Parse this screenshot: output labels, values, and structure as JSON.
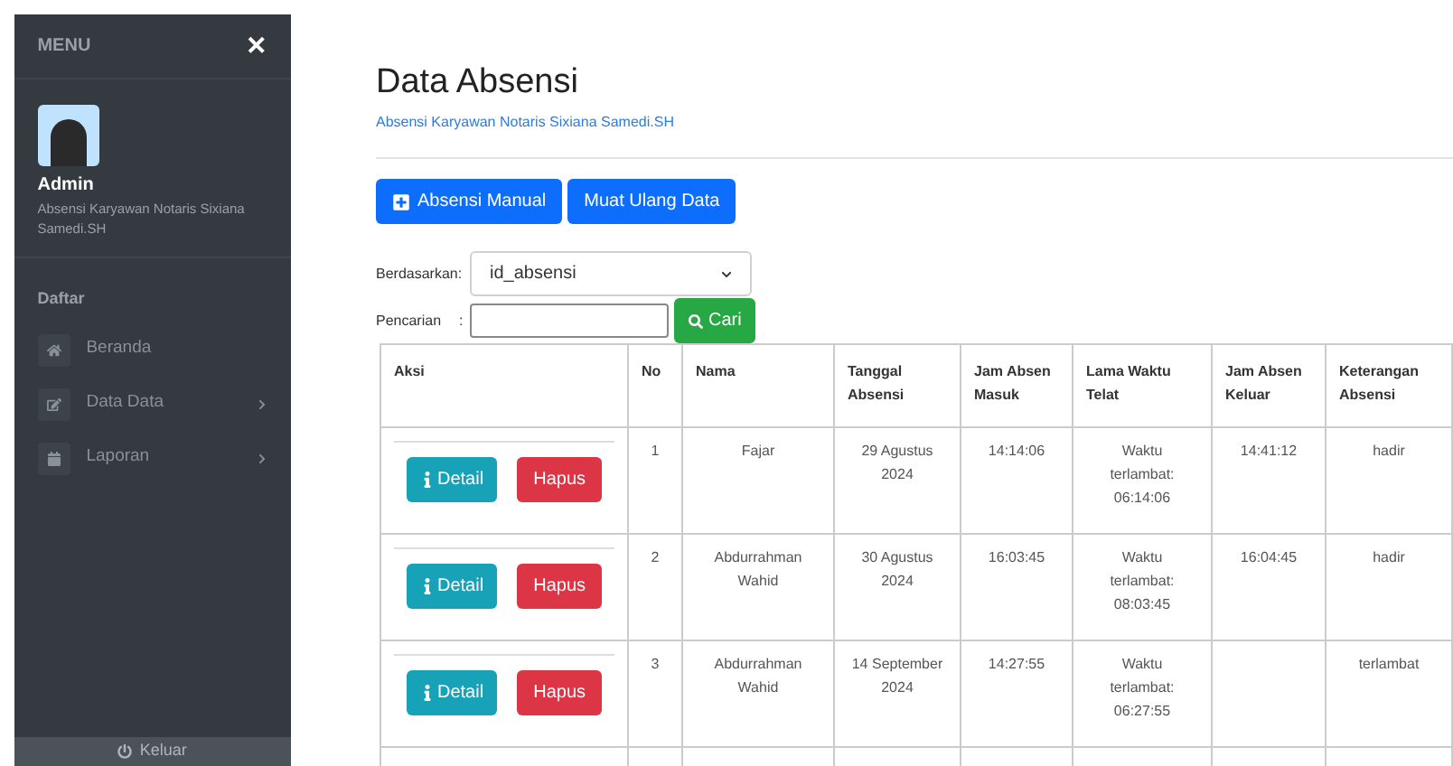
{
  "sidebar": {
    "title": "MENU",
    "close": "✕",
    "user": {
      "name": "Admin",
      "subtitle": "Absensi Karyawan Notaris Sixiana Samedi.SH"
    },
    "section": "Daftar",
    "items": [
      {
        "kind": "home",
        "label": "Beranda",
        "has_submenu": false
      },
      {
        "kind": "edit",
        "label": "Data Data",
        "has_submenu": true
      },
      {
        "kind": "calendar",
        "label": "Laporan",
        "has_submenu": true
      }
    ],
    "logout": "Keluar"
  },
  "page": {
    "title": "Data Absensi",
    "subtitle": "Absensi Karyawan Notaris Sixiana Samedi.SH",
    "buttons": [
      {
        "kind": "add",
        "label": "Absensi Manual"
      },
      {
        "kind": "plain",
        "label": "Muat Ulang Data"
      }
    ],
    "filter": {
      "label": "Berdasarkan:",
      "value": "id_absensi"
    },
    "search": {
      "label": "Pencarian",
      "colon": ":",
      "button": "Cari"
    }
  },
  "table": {
    "columns": [
      "Aksi",
      "No",
      "Nama",
      "Tanggal Absensi",
      "Jam Absen Masuk",
      "Lama Waktu Telat",
      "Jam Absen Keluar",
      "Keterangan Absensi"
    ],
    "rows": [
      {
        "detail": "Detail",
        "delete": "Hapus",
        "no": "1",
        "nama": "Fajar",
        "tanggal": "29 Agustus 2024",
        "masuk": "14:14:06",
        "telat": "Waktu terlambat: 06:14:06",
        "keluar": "14:41:12",
        "keterangan": "hadir"
      },
      {
        "detail": "Detail",
        "delete": "Hapus",
        "no": "2",
        "nama": "Abdurrahman Wahid",
        "tanggal": "30 Agustus 2024",
        "masuk": "16:03:45",
        "telat": "Waktu terlambat: 08:03:45",
        "keluar": "16:04:45",
        "keterangan": "hadir"
      },
      {
        "detail": "Detail",
        "delete": "Hapus",
        "no": "3",
        "nama": "Abdurrahman Wahid",
        "tanggal": "14 September 2024",
        "masuk": "14:27:55",
        "telat": "Waktu terlambat: 06:27:55",
        "keterangan": "terlambat"
      }
    ]
  }
}
